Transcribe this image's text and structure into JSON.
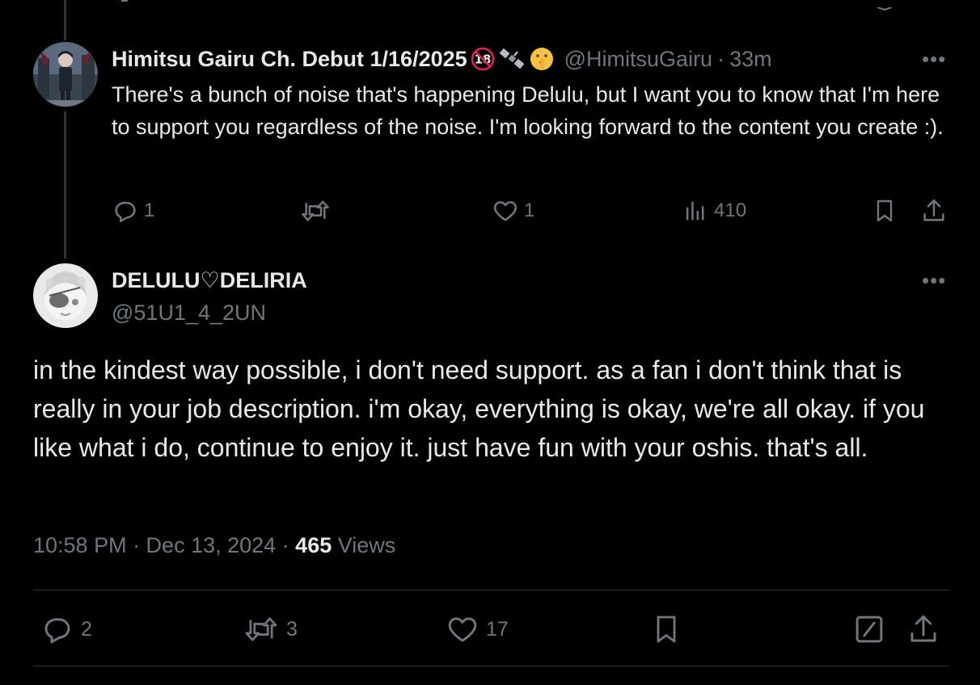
{
  "reply": {
    "display_name": "Himitsu Gairu Ch. Debut 1/16/2025",
    "handle": "@HimitsuGairu",
    "separator": "·",
    "time": "33m",
    "body": "There's a bunch of noise that's happening Delulu, but I want you to know that I'm here to support you regardless of the noise. I'm  looking forward to the content you create :).",
    "actions": {
      "replies": "1",
      "reposts": "",
      "likes": "1",
      "views": "410"
    },
    "badges": [
      "no-under-18-icon",
      "satellite-icon",
      "shushing-face-icon"
    ]
  },
  "main": {
    "display_name": "DELULU♡DELIRIA",
    "handle": "@51U1_4_2UN",
    "body": "in the kindest way possible, i don't need support. as a fan i don't think that is really in your job description.  i'm okay, everything is okay, we're all okay. if you like what i do, continue to enjoy it. just have fun with your oshis. that's all.",
    "timestamp": "10:58 PM · Dec 13, 2024 · ",
    "views_count": "465",
    "views_label": " Views",
    "actions": {
      "replies": "2",
      "reposts": "3",
      "likes": "17"
    }
  },
  "more_label": "•••",
  "colors": {
    "background": "#000000",
    "text": "#e7e9ea",
    "muted": "#71767b",
    "divider": "#2f3336"
  }
}
